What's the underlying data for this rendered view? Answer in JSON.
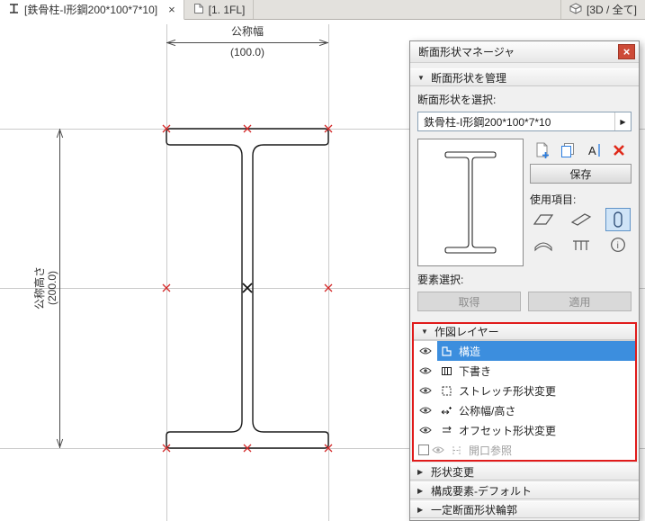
{
  "colors": {
    "selection_blue": "#3c8ede",
    "annotation_red": "#e01b1b",
    "close_red": "#cd4b38",
    "marker_red": "#d42a2a"
  },
  "icons": {
    "collapse": "▼",
    "expand": "▶",
    "dropdown": "▶",
    "tab_close": "×",
    "panel_close": "×",
    "info": "i",
    "rename": "A"
  },
  "tabs": [
    {
      "label": "[鉄骨柱-I形鋼200*100*7*10]"
    },
    {
      "label": "[1. 1FL]"
    },
    {
      "label": "[3D / 全て]"
    }
  ],
  "canvas": {
    "width_dim": {
      "label": "公称幅",
      "value": "(100.0)"
    },
    "height_dim": {
      "label": "公称高さ",
      "value": "(200.0)"
    }
  },
  "panel": {
    "title": "断面形状マネージャ",
    "manage_header": "断面形状を管理",
    "select_label": "断面形状を選択:",
    "profile_name": "鉄骨柱-I形鋼200*100*7*10",
    "save_button": "保存",
    "use_label": "使用項目:",
    "element_label": "要素選択:",
    "pickup_button": "取得",
    "apply_button": "適用",
    "layers_header": "作図レイヤー",
    "layers": [
      {
        "label": "構造",
        "selected": true
      },
      {
        "label": "下書き"
      },
      {
        "label": "ストレッチ形状変更"
      },
      {
        "label": "公称幅/高さ"
      },
      {
        "label": "オフセット形状変更"
      },
      {
        "label": "開口参照",
        "disabled": true
      }
    ],
    "bottom_sections": [
      {
        "label": "形状変更"
      },
      {
        "label": "構成要素-デフォルト"
      },
      {
        "label": "一定断面形状輪郭"
      }
    ]
  }
}
